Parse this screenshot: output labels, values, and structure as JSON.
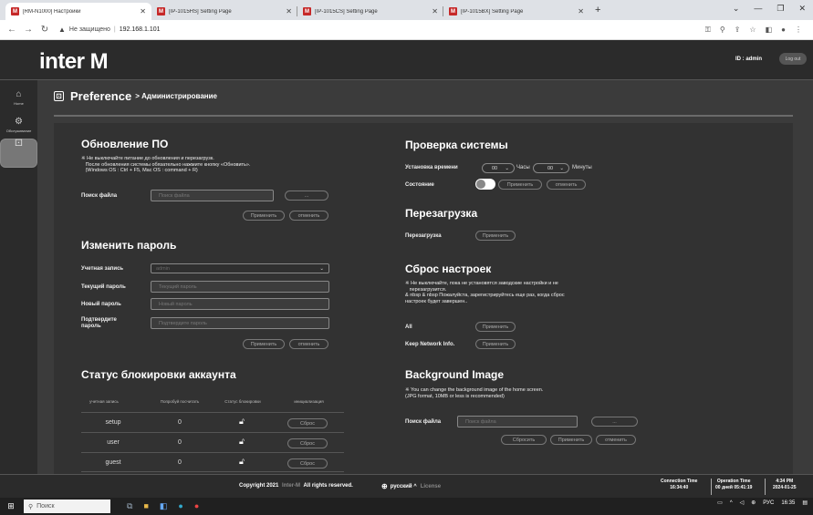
{
  "browser": {
    "tabs": [
      {
        "favicon": "M",
        "title": "[RM-N1000] Настройки",
        "active": true
      },
      {
        "favicon": "M",
        "title": "[IP-1015HS] Setting Page",
        "active": false
      },
      {
        "favicon": "M",
        "title": "[IP-1015CS] Setting Page",
        "active": false
      },
      {
        "favicon": "M",
        "title": "[IP-1015BX] Setting Page",
        "active": false
      }
    ],
    "security_label": "Не защищено",
    "url": "192.168.1.101"
  },
  "header": {
    "logo": "inter M",
    "user_id": "ID : admin",
    "logout": "Log out"
  },
  "sidenav": [
    {
      "label": "Home",
      "icon": "home-icon"
    },
    {
      "label": "Обслуживание",
      "icon": "gear-icon"
    },
    {
      "label": "",
      "icon": "preference-icon",
      "selected": true
    }
  ],
  "page": {
    "title": "Preference",
    "subtitle": "> Администрирование"
  },
  "update": {
    "title": "Обновление ПО",
    "note": "※ Не выключайте питание до обновления и перезагрузк.\n   После обновления системы обязательно нажмите кнопку «Обновить».\n   (Windows OS : Ctrl + F5, Mac OS : command + R)",
    "file_label": "Поиск файла",
    "file_placeholder": "Поиск файла",
    "browse": "...",
    "apply": "Применить",
    "cancel": "отменить"
  },
  "password": {
    "title": "Изменить пароль",
    "account_label": "Учетная запись",
    "account_value": "admin",
    "current_label": "Текущий пароль",
    "current_placeholder": "Текущий пароль",
    "new_label": "Новый пароль",
    "new_placeholder": "Новый пароль",
    "confirm_label": "Подтвердите\nпароль",
    "confirm_placeholder": "Подтвердите пароль",
    "apply": "Применить",
    "cancel": "отменить"
  },
  "lock": {
    "title": "Статус блокировки аккаунта",
    "columns": [
      "учетная запись",
      "Попробуй посчитать",
      "Статус блокировки",
      "инициализация"
    ],
    "rows": [
      {
        "account": "setup",
        "count": "0",
        "reset": "Сброс"
      },
      {
        "account": "user",
        "count": "0",
        "reset": "Сброс"
      },
      {
        "account": "guest",
        "count": "0",
        "reset": "Сброс"
      }
    ]
  },
  "syscheck": {
    "title": "Проверка системы",
    "time_label": "Установка времени",
    "hours_value": "00",
    "hours_unit": "Часы",
    "minutes_value": "00",
    "minutes_unit": "Минуты",
    "state_label": "Состояние",
    "apply": "Применить",
    "cancel": "отменить"
  },
  "reboot": {
    "title": "Перезагрузка",
    "label": "Перезагрузка",
    "apply": "Применить"
  },
  "reset": {
    "title": "Сброс настроек",
    "note": "※ Не выключайте, пока не установятся заводские настройки и не\n   перезагрузится.\n& nbsp & nbsp Пожалуйста, зарегистрируйтесь еще раз, когда сброс\nнастроек будет завершен..",
    "all_label": "All",
    "keep_label": "Keep Network Info.",
    "apply": "Применить"
  },
  "background": {
    "title": "Background Image",
    "note": "※ You can change the background image of the home screen.\n(JPG format, 10MB or less is recommended)",
    "file_label": "Поиск файла",
    "file_placeholder": "Поиск файла",
    "browse": "...",
    "reset": "Сбросить",
    "apply": "Применить",
    "cancel": "отменить"
  },
  "footer": {
    "copyright": "Copyright 2021",
    "brand": "Inter-M",
    "rights": "All rights reserved.",
    "language": "русский ^",
    "license": "License",
    "connection_label": "Connection Time",
    "connection_value": "16:34:40",
    "operation_label": "Operation Time",
    "operation_value": "00 дней 05:41:19",
    "time": "4:34 PM",
    "date": "2024-01-25"
  },
  "taskbar": {
    "search": "Поиск",
    "lang": "РУС",
    "clock": "16:35"
  }
}
